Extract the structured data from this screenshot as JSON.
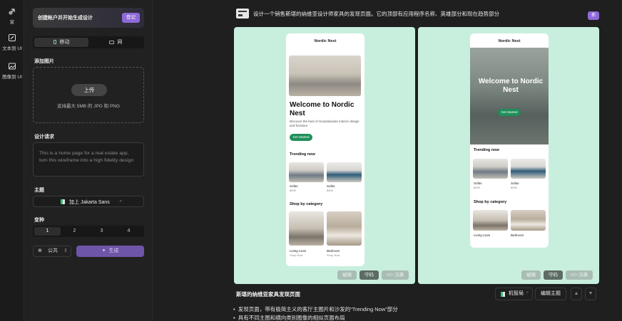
{
  "rail": {
    "items": [
      {
        "label": "家",
        "icon": "home-icon"
      },
      {
        "label": "文本到 UI",
        "icon": "edit-icon"
      },
      {
        "label": "图像到 UI",
        "icon": "image-icon"
      }
    ]
  },
  "panel": {
    "banner": {
      "text": "创建帐户并开始生成设计",
      "button": "登记"
    },
    "device_tabs": [
      "移动",
      "网"
    ],
    "add_image_label": "添加图片",
    "upload": {
      "button": "上传",
      "hint": "支持最大 5MB 的 JPG 和 PNG"
    },
    "design_request_label": "设计请求",
    "design_request_placeholder": "This is a home page for a real estate app, turn this wireframe into a high fidelity design",
    "theme_label": "主题",
    "theme_value": "加上 Jakarta Sans",
    "variants_label": "变种",
    "variants": [
      "1",
      "2",
      "3",
      "4"
    ],
    "visibility": "公共",
    "generate": "生成"
  },
  "main": {
    "prompt": "设计一个销售斯堪的纳维亚设计师家具的发现页面。它的顶部有应用程序名称、英雄部分和现在趋势部分",
    "badge": "抓",
    "result_title": "斯堪的纳维亚家具发现页面",
    "bullets": [
      "发现页面，带有极简主义的客厅主图片和沙发的“Trending Now”部分",
      "具有不同主图和横向类别图像的相似页面布局"
    ],
    "card_tools": {
      "edit": "编辑",
      "code": "守码",
      "method": "法典"
    },
    "theme_chip": "机智局",
    "edit_theme": "编辑主题"
  },
  "mock1": {
    "brand": "Nordic Nest",
    "headline": "Welcome to Nordic Nest",
    "sub": "Discover the best of Scandinavian interior design and furniture",
    "cta": "Get Started",
    "trending": "Trending now",
    "items": [
      {
        "name": "Sofas",
        "price": "$999"
      },
      {
        "name": "Sofas",
        "price": "$999"
      }
    ],
    "shop": "Shop by category",
    "cats": [
      {
        "name": "Living room",
        "sub": "Shop Now"
      },
      {
        "name": "Bedroom",
        "sub": "Shop Now"
      }
    ]
  },
  "mock2": {
    "brand": "Nordic Nest",
    "headline": "Welcome to Nordic Nest",
    "cta": "Get Started",
    "trending": "Trending now",
    "items": [
      {
        "name": "Sofas",
        "price": "$999"
      },
      {
        "name": "Sofas",
        "price": "$999"
      }
    ],
    "shop": "Shop by category",
    "cats": [
      {
        "name": "Living room"
      },
      {
        "name": "Bedroom"
      }
    ]
  }
}
